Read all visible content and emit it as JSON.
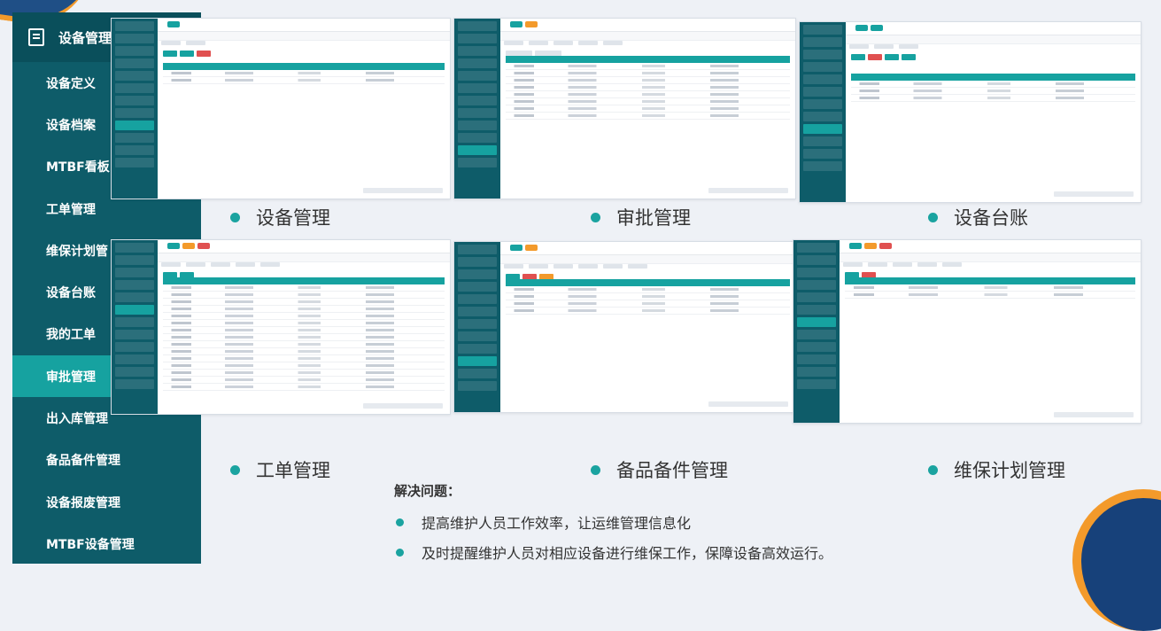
{
  "sidebar": {
    "header": "设备管理",
    "items": [
      {
        "label": "设备定义",
        "active": false
      },
      {
        "label": "设备档案",
        "active": false
      },
      {
        "label": "MTBF看板",
        "active": false
      },
      {
        "label": "工单管理",
        "active": false
      },
      {
        "label": "维保计划管",
        "active": false
      },
      {
        "label": "设备台账",
        "active": false
      },
      {
        "label": "我的工单",
        "active": false
      },
      {
        "label": "审批管理",
        "active": true
      },
      {
        "label": "出入库管理",
        "active": false
      },
      {
        "label": "备品备件管理",
        "active": false
      },
      {
        "label": "设备报废管理",
        "active": false
      },
      {
        "label": "MTBF设备管理",
        "active": false
      }
    ]
  },
  "modules": [
    {
      "caption": "设备管理"
    },
    {
      "caption": "审批管理"
    },
    {
      "caption": "设备台账"
    },
    {
      "caption": "工单管理"
    },
    {
      "caption": "备品备件管理"
    },
    {
      "caption": "维保计划管理"
    }
  ],
  "problems": {
    "title": "解决问题：",
    "items": [
      "提高维护人员工作效率，让运维管理信息化",
      "及时提醒维护人员对相应设备进行维保工作，保障设备高效运行。"
    ]
  },
  "colors": {
    "sidebar": "#0e5c69",
    "accent": "#16a2a0",
    "deco_blue": "#1f4f86",
    "deco_orange": "#f39a2b"
  }
}
